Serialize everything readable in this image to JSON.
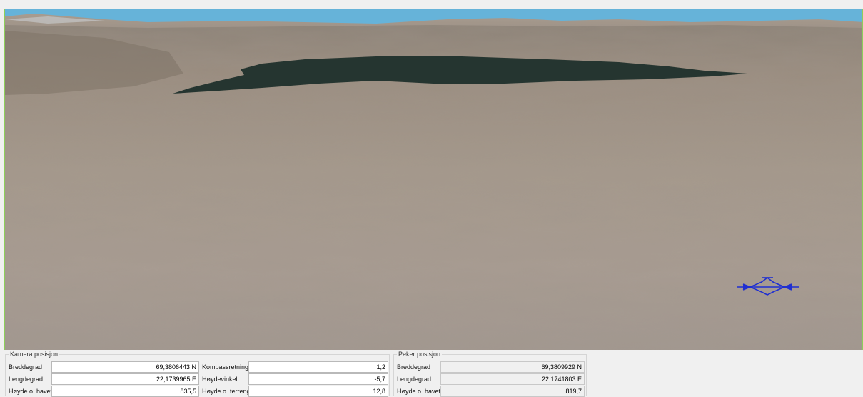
{
  "camera": {
    "title": "Kamera posisjon",
    "lat_label": "Breddegrad",
    "lat_value": "69,3806443 N",
    "lon_label": "Lengdegrad",
    "lon_value": "22,1739965 E",
    "alt_label": "Høyde o. havet",
    "alt_value": "835,5",
    "heading_label": "Kompassretning",
    "heading_value": "1,2",
    "tilt_label": "Høydevinkel",
    "tilt_value": "-5,7",
    "terrain_label": "Høyde o. terreng",
    "terrain_value": "12,8"
  },
  "pointer": {
    "title": "Peker posisjon",
    "lat_label": "Breddegrad",
    "lat_value": "69,3809929 N",
    "lon_label": "Lengdegrad",
    "lon_value": "22,1741803 E",
    "alt_label": "Høyde o. havet",
    "alt_value": "819,7"
  },
  "icons": {
    "view_marker": "crosshair-direction-icon"
  },
  "colors": {
    "sky": "#66b3d9",
    "terrain": "#a89888",
    "lake": "#253530",
    "marker": "#1f2fd1",
    "viewport_border": "#8ccf5a"
  }
}
